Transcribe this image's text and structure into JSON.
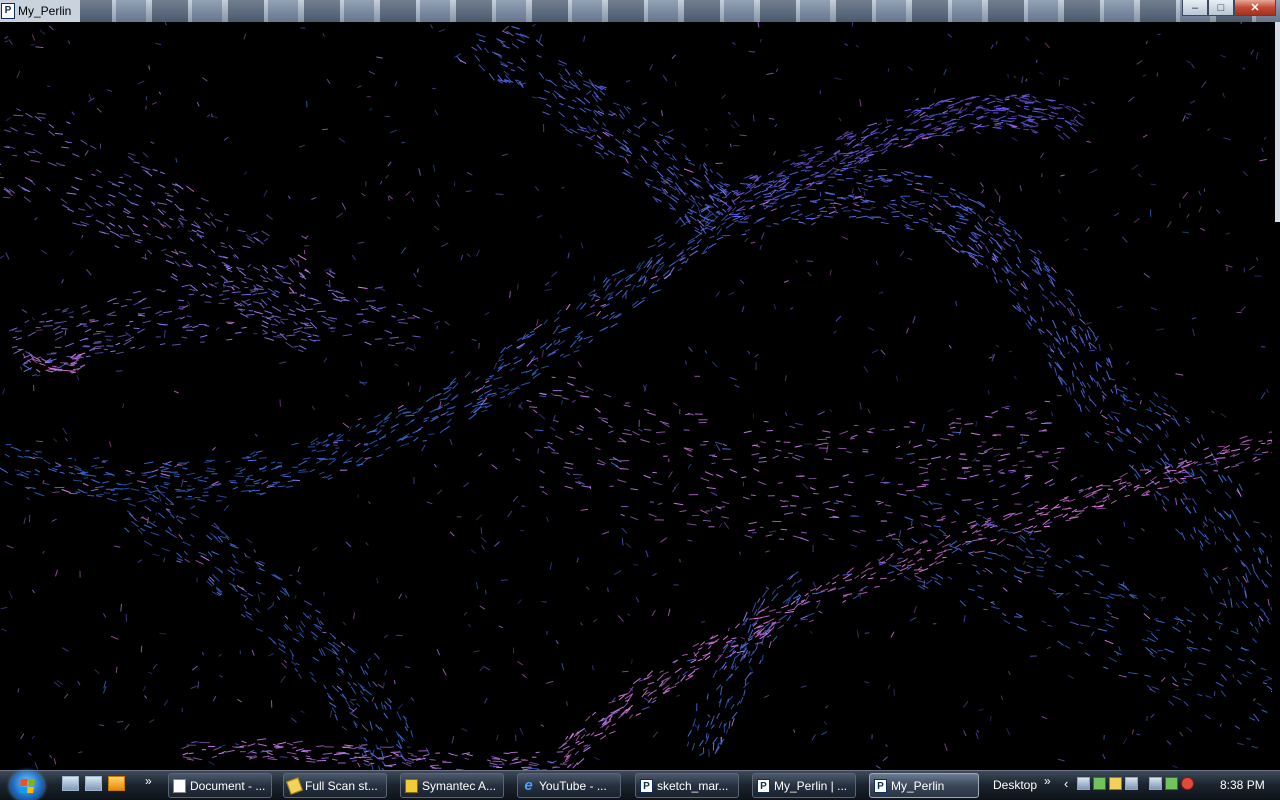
{
  "window": {
    "title": "My_Perlin",
    "app_icon_letter": "P",
    "minimize_glyph": "–",
    "maximize_glyph": "□",
    "close_glyph": "✕"
  },
  "canvas": {
    "background": "#000000",
    "stroke_colors": [
      "#5a6cf0",
      "#6f58e8",
      "#3f6fe0",
      "#c77df0",
      "#e27ee8",
      "#8e7cf6"
    ]
  },
  "taskbar": {
    "quicklaunch_overflow": "»",
    "buttons": [
      {
        "label": "Document - ...",
        "icon": "document-icon"
      },
      {
        "label": "Full Scan st...",
        "icon": "scan-icon"
      },
      {
        "label": "Symantec A...",
        "icon": "symantec-icon"
      },
      {
        "label": "YouTube - ...",
        "icon": "internet-explorer-icon"
      },
      {
        "label": "sketch_mar...",
        "icon": "processing-icon"
      },
      {
        "label": "My_Perlin | ...",
        "icon": "processing-icon"
      },
      {
        "label": "My_Perlin",
        "icon": "processing-icon",
        "active": true
      }
    ],
    "desktop_label": "Desktop",
    "desktop_overflow": "»",
    "tray_arrow": "‹",
    "clock": "8:38 PM"
  }
}
